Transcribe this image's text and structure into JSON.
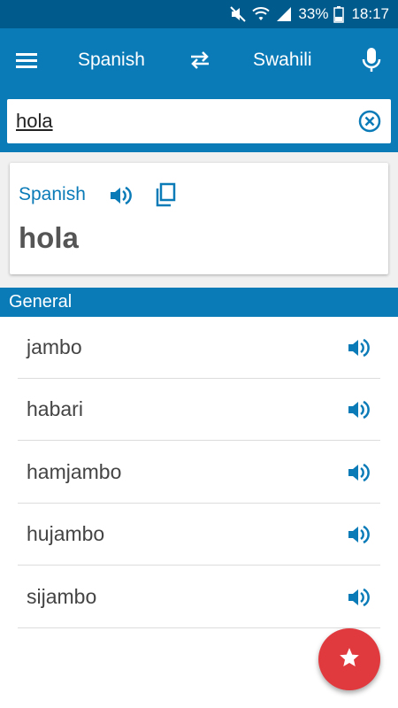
{
  "status_bar": {
    "battery_percent": "33%",
    "time": "18:17",
    "icons": [
      "mute-icon",
      "wifi-icon",
      "signal-icon",
      "battery-icon"
    ]
  },
  "app_bar": {
    "menu_icon": "hamburger-menu-icon",
    "source_language": "Spanish",
    "swap_icon": "swap-arrows-icon",
    "target_language": "Swahili",
    "mic_icon": "microphone-icon"
  },
  "search": {
    "value": "hola",
    "clear_icon": "clear-circle-icon"
  },
  "entry_card": {
    "language": "Spanish",
    "word": "hola",
    "speaker_icon": "speaker-icon",
    "copy_icon": "copy-icon"
  },
  "section": {
    "title": "General"
  },
  "results": [
    {
      "text": "jambo"
    },
    {
      "text": "habari"
    },
    {
      "text": "hamjambo"
    },
    {
      "text": "hujambo"
    },
    {
      "text": "sijambo"
    }
  ],
  "fab": {
    "icon": "star-icon"
  },
  "colors": {
    "primary": "#0b7bb8",
    "status_bar": "#005a8c",
    "fab": "#e0393e",
    "word": "#555555"
  }
}
